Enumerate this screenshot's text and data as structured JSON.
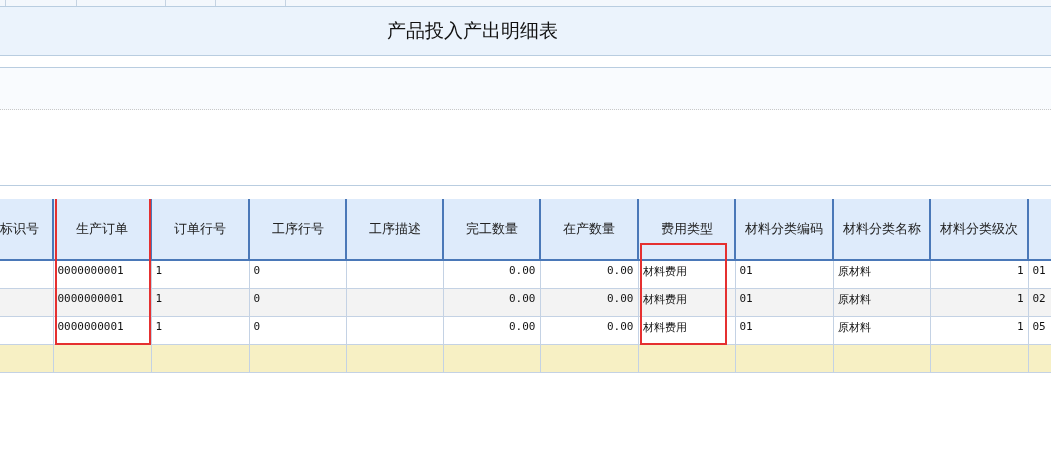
{
  "title": "产品投入产出明细表",
  "table": {
    "columns": [
      {
        "label": "标识号",
        "highlighted": false
      },
      {
        "label": "生产订单",
        "highlighted": true,
        "header_highlighted": true
      },
      {
        "label": "订单行号",
        "highlighted": false
      },
      {
        "label": "工序行号",
        "highlighted": false
      },
      {
        "label": "工序描述",
        "highlighted": false
      },
      {
        "label": "完工数量",
        "highlighted": false
      },
      {
        "label": "在产数量",
        "highlighted": false
      },
      {
        "label": "费用类型",
        "highlighted": true,
        "header_highlighted": false
      },
      {
        "label": "材料分类编码",
        "highlighted": false
      },
      {
        "label": "材料分类名称",
        "highlighted": false
      },
      {
        "label": "材料分类级次",
        "highlighted": false
      },
      {
        "highlighted": false
      }
    ],
    "rows": [
      [
        null,
        "0000000001",
        "1",
        "0",
        null,
        "0.00",
        "0.00",
        "材料费用",
        "01",
        "原材料",
        "1",
        "01"
      ],
      [
        null,
        "0000000001",
        "1",
        "0",
        null,
        "0.00",
        "0.00",
        "材料费用",
        "01",
        "原材料",
        "1",
        "02"
      ],
      [
        null,
        "0000000001",
        "1",
        "0",
        null,
        "0.00",
        "0.00",
        "材料费用",
        "01",
        "原材料",
        "1",
        "05"
      ]
    ]
  }
}
